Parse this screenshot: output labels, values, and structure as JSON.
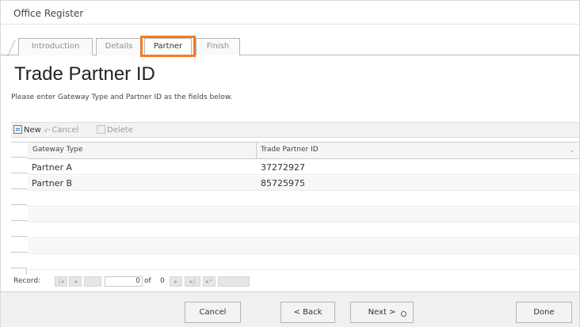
{
  "window": {
    "title": "Office Register"
  },
  "tabs": [
    {
      "label": "Introduction"
    },
    {
      "label": "Details"
    },
    {
      "label": "Partner"
    },
    {
      "label": "Finish"
    }
  ],
  "page": {
    "title": "Trade Partner ID",
    "instructions": "Please enter Gateway Type and Partner ID as the fields below."
  },
  "toolbar": {
    "new_label": "New",
    "cancel_label": "Cancel",
    "delete_label": "Delete"
  },
  "grid": {
    "columns": [
      "Gateway Type",
      "Trade Partner ID"
    ],
    "rows": [
      {
        "gateway_type": "Partner A",
        "trade_partner_id": "37272927"
      },
      {
        "gateway_type": "Partner B",
        "trade_partner_id": "85725975"
      }
    ]
  },
  "pager": {
    "label": "Record:",
    "current": "0",
    "of_label": "of",
    "total": "0"
  },
  "footer": {
    "cancel_label": "Cancel",
    "back_label": "< Back",
    "next_label": "Next >",
    "done_label": "Done"
  },
  "colors": {
    "active_tab_highlight": "#f47a20",
    "toolbar_bg": "#f2f2f2",
    "footer_bg": "#f0f0f0"
  }
}
